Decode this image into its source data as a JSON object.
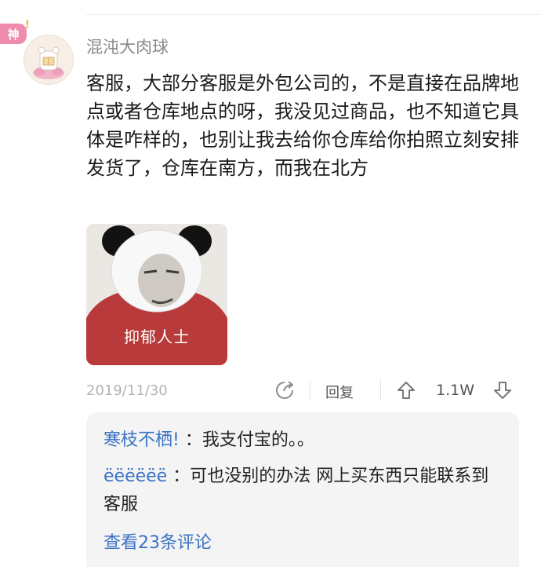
{
  "badge": {
    "label": "神"
  },
  "comment": {
    "username": "混沌大肉球",
    "text": "客服，大部分客服是外包公司的，不是直接在品牌地点或者仓库地点的呀，我没见过商品，也不知道它具体是咋样的，也别让我去给你仓库给你拍照立刻安排发货了，仓库在南方，而我在北方",
    "meme_caption": "抑郁人士",
    "date": "2019/11/30",
    "reply_label": "回复",
    "upvotes": "1.1W"
  },
  "replies": {
    "items": [
      {
        "user": "寒枝不栖!",
        "text": "：我支付宝的。。"
      },
      {
        "user": "ëëëëëë",
        "text": "：可也没别的办法   网上买东西只能联系到客服"
      }
    ],
    "view_more": "查看23条评论"
  },
  "colors": {
    "link": "#3a72c4",
    "meta": "#b3b3b3",
    "badge": "#ef8cae",
    "reply_bg": "#f4f4f4"
  }
}
